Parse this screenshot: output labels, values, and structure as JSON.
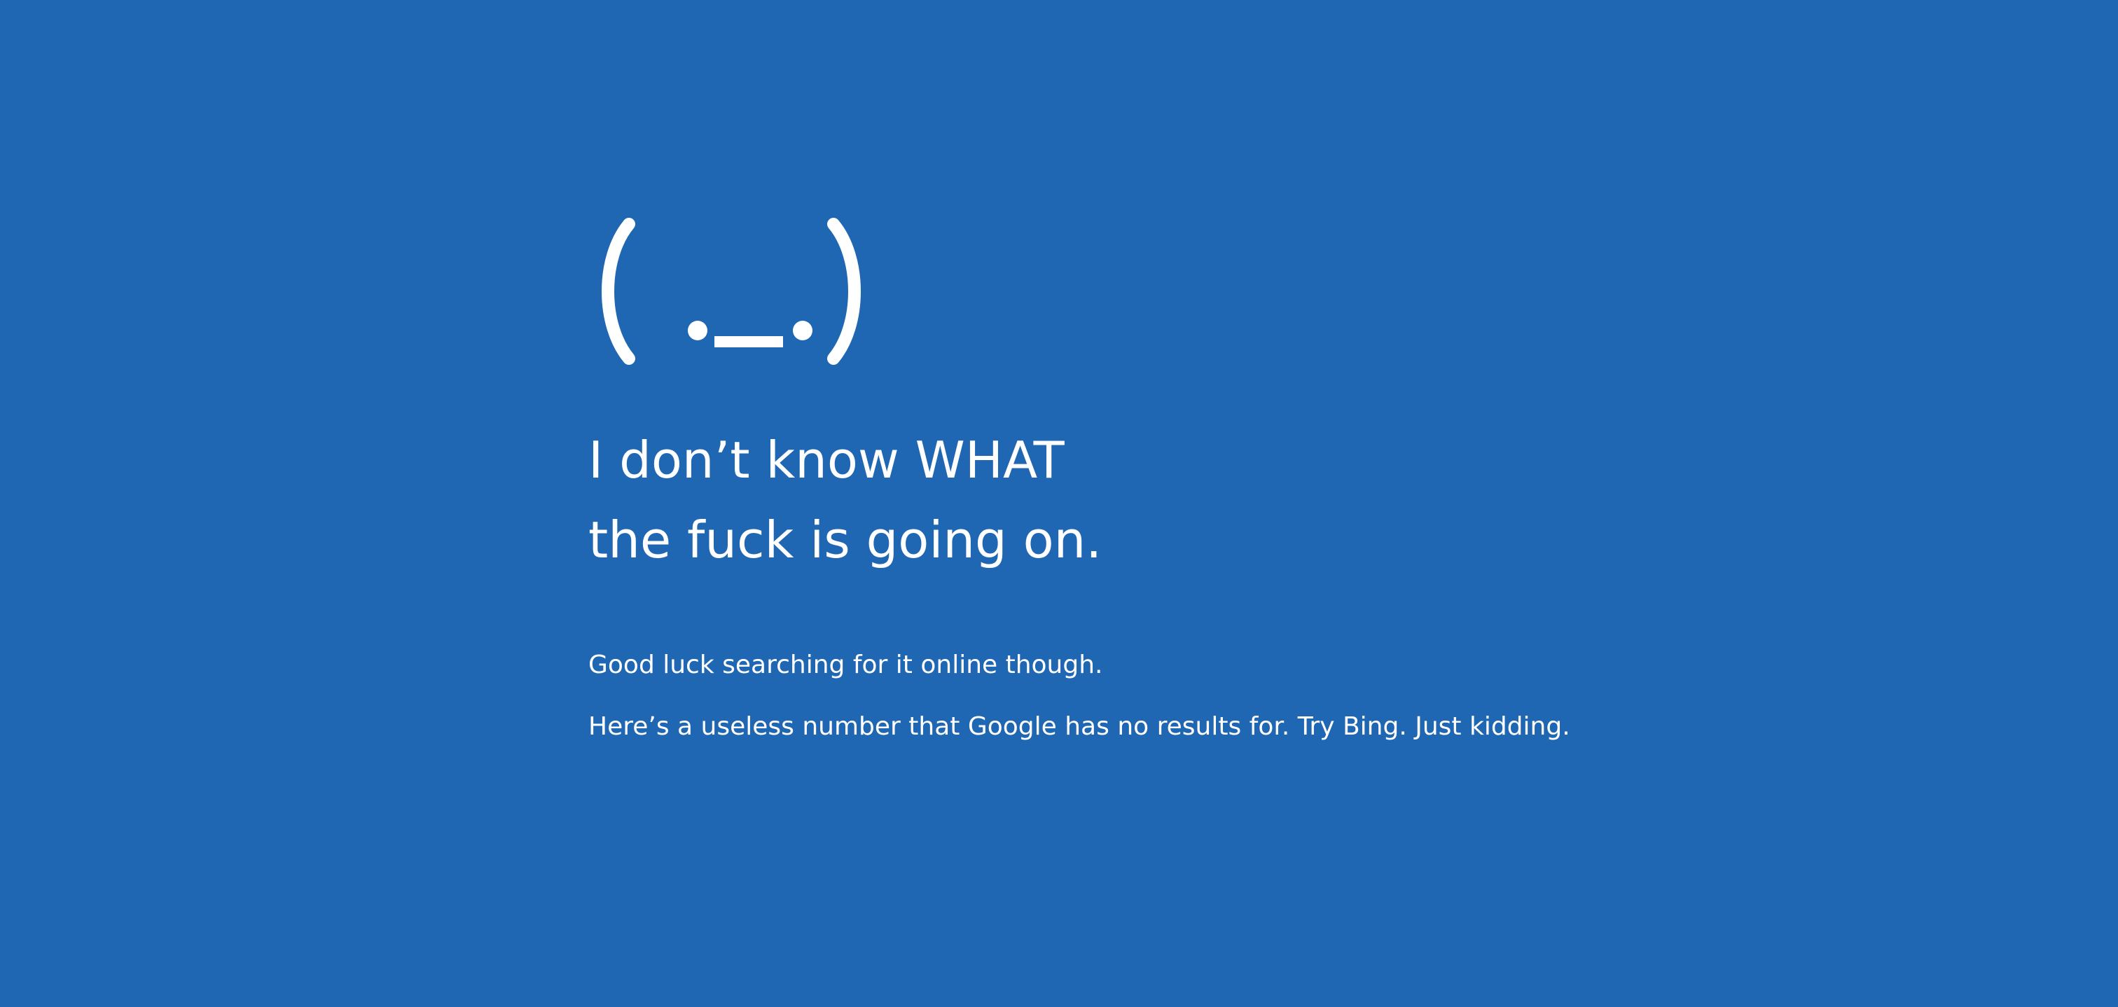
{
  "screen": {
    "background_color": "#2067b3",
    "text_color": "#ffffff",
    "face_icon": "sad-face-emoticon-icon",
    "headline": {
      "line_1": "I don’t know WHAT",
      "line_2": "the fuck is going on."
    },
    "messages": {
      "line_1": "Good luck searching for it online though.",
      "line_2": "Here’s a useless number that Google has no results for. Try Bing. Just kidding."
    }
  }
}
